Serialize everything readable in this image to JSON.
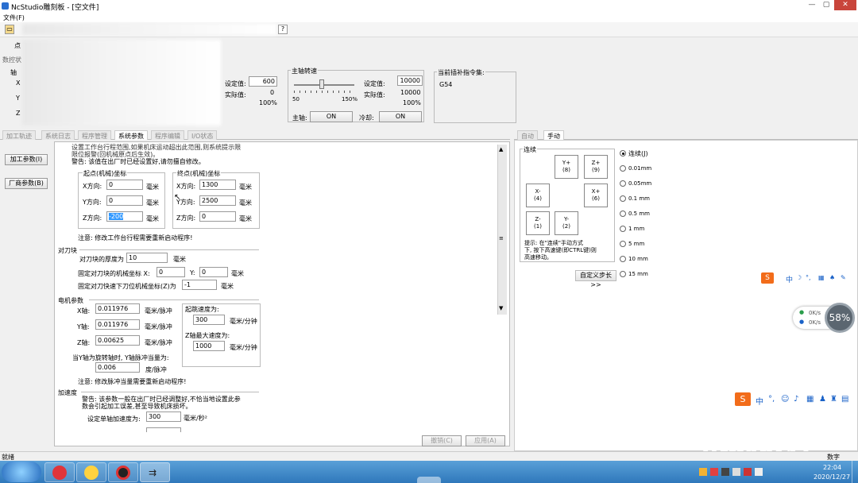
{
  "window": {
    "title": "NcStudio雕刻板 - [空文件]"
  },
  "menu": {
    "file": "文件(F)"
  },
  "status_panel": {
    "label_partial": "数控状",
    "axis": "轴",
    "x": "X",
    "y": "Y",
    "z": "Z",
    "pt": "点"
  },
  "feed": {
    "set_label": "设定值:",
    "set_value": "600",
    "actual_label": "实际值:",
    "actual_value": "0",
    "percent": "100%"
  },
  "spindle": {
    "title": "主轴转速",
    "scale_min": "50",
    "scale_max": "150%",
    "set_label": "设定值:",
    "set_value": "10000",
    "actual_label": "实际值:",
    "actual_value": "10000",
    "percent": "100%",
    "spindle_label": "主轴:",
    "spindle_btn": "ON",
    "cool_label": "冷却:",
    "cool_btn": "ON"
  },
  "command_set": {
    "title": "当前插补指令集:",
    "value": "G54"
  },
  "tabs": [
    "加工轨迹",
    "系统日志",
    "程序管理",
    "系统参数",
    "程序编辑",
    "I/O状态"
  ],
  "side_buttons": {
    "machining": "加工参数(I)",
    "factory": "厂商参数(B)"
  },
  "params": {
    "top_text1": "设置工作台行程范围,如果机床运动超出此范围,则系统提示限",
    "top_text2": "限位报警(回机械原点后生效)。",
    "warning": "警告: 该值在出厂时已经设置好,请勿擅自修改。",
    "start_title": "起点(机械)坐标",
    "end_title": "终点(机械)坐标",
    "x_label": "X方向:",
    "y_label": "Y方向:",
    "z_label": "Z方向:",
    "start_x": "0",
    "start_y": "0",
    "start_z": "-200",
    "end_x": "1300",
    "end_y": "2500",
    "end_z": "0",
    "unit_mm": "毫米",
    "note_restart": "注意: 修改工作台行程需要重新启动程序!",
    "tool_title": "对刀块",
    "tool_thickness_label": "对刀块的厚度为",
    "tool_thickness": "10",
    "tool_fixed_label": "固定对刀块的机械坐标 X:",
    "tool_fixed_x": "0",
    "tool_fixed_y_label": "Y:",
    "tool_fixed_y": "0",
    "tool_fast_label": "固定对刀快速下刀位机械坐标(Z)为",
    "tool_fast": "-1",
    "motor_title": "电机参数",
    "motor_x_label": "X轴:",
    "motor_x": "0.011976",
    "motor_y_label": "Y轴:",
    "motor_y": "0.011976",
    "motor_z_label": "Z轴:",
    "motor_z": "0.00625",
    "unit_pulse": "毫米/脉冲",
    "rotary_label": "当Y轴为旋转轴时, Y轴脉冲当量为:",
    "rotary_value": "0.006",
    "unit_deg_pulse": "度/脉冲",
    "jump_label": "起跳速度为:",
    "jump_value": "300",
    "unit_speed": "毫米/分钟",
    "zmax_label": "Z轴最大速度为:",
    "zmax_value": "1000",
    "note_pulse": "注意: 修改脉冲当量需要重新启动程序!",
    "accel_title": "加速度",
    "accel_warn1": "警告: 该参数一般在出厂时已经调整好,不恰当地设置此参",
    "accel_warn2": "数会引起加工误差,甚至导致机床损坏。",
    "single_accel_label": "设定单轴加速度为:",
    "single_accel": "300",
    "unit_accel": "毫米/秒²",
    "cancel_btn": "撤销(C)",
    "apply_btn": "应用(A)"
  },
  "manual": {
    "tabs": [
      "自动",
      "手动"
    ],
    "group": "连续",
    "buttons": [
      {
        "a": "Y+",
        "b": "(8)"
      },
      {
        "a": "Z+",
        "b": "(9)"
      },
      {
        "a": "X-",
        "b": "(4)"
      },
      {
        "a": "X+",
        "b": "(6)"
      },
      {
        "a": "Z-",
        "b": "(1)"
      },
      {
        "a": "Y-",
        "b": "(2)"
      }
    ],
    "hint1": "提示: 在\"连续\"手动方式",
    "hint2": "下, 按下高速键(即CTRL键)则",
    "hint3": "高速移动。",
    "custom_step": "自定义步长>>",
    "steps": [
      "连续(J)",
      "0.01mm",
      "0.05mm",
      "0.1 mm",
      "0.5 mm",
      "1 mm",
      "5 mm",
      "10 mm",
      "15 mm"
    ]
  },
  "overlay": {
    "net_up": "0K/s",
    "net_down": "0K/s",
    "cpu": "58%",
    "watermark": "迅刻数控",
    "ime1": "中",
    "ime2": "中"
  },
  "statusbar": {
    "left": "就绪",
    "right": "数字"
  },
  "taskbar": {
    "time": "22:04",
    "date": "2020/12/27"
  },
  "colors": {
    "taskbar": "#2f78bb",
    "watermark": "#1b3fa0",
    "accent": "#e05a14"
  }
}
